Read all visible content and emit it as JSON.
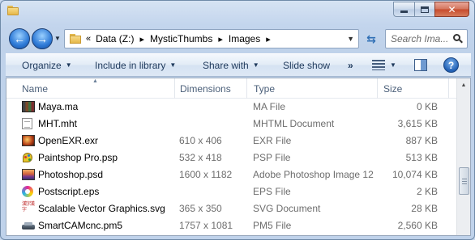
{
  "address": {
    "overflow": "«",
    "crumbs": [
      "Data (Z:)",
      "MysticThumbs",
      "Images"
    ]
  },
  "search": {
    "placeholder": "Search Ima..."
  },
  "toolbar": {
    "organize": "Organize",
    "include_in_library": "Include in library",
    "share_with": "Share with",
    "slide_show": "Slide show",
    "more": "»"
  },
  "columns": {
    "name": "Name",
    "dimensions": "Dimensions",
    "type": "Type",
    "size": "Size"
  },
  "files": [
    {
      "icon": "maya-file-icon",
      "name": "Maya.ma",
      "dimensions": "",
      "type": "MA File",
      "size": "0 KB"
    },
    {
      "icon": "mhtml-file-icon",
      "name": "MHT.mht",
      "dimensions": "",
      "type": "MHTML Document",
      "size": "3,615 KB"
    },
    {
      "icon": "exr-image-icon",
      "name": "OpenEXR.exr",
      "dimensions": "610 x 406",
      "type": "EXR File",
      "size": "887 KB"
    },
    {
      "icon": "paintshop-file-icon",
      "name": "Paintshop Pro.psp",
      "dimensions": "532 x 418",
      "type": "PSP File",
      "size": "513 KB"
    },
    {
      "icon": "psd-image-icon",
      "name": "Photoshop.psd",
      "dimensions": "1600 x 1182",
      "type": "Adobe Photoshop Image 12",
      "size": "10,074 KB"
    },
    {
      "icon": "eps-file-icon",
      "name": "Postscript.eps",
      "dimensions": "",
      "type": "EPS File",
      "size": "2 KB"
    },
    {
      "icon": "svg-image-icon",
      "name": "Scalable Vector Graphics.svg",
      "dimensions": "365 x 350",
      "type": "SVG Document",
      "size": "28 KB"
    },
    {
      "icon": "cnc-machine-icon",
      "name": "SmartCAMcnc.pm5",
      "dimensions": "1757 x 1081",
      "type": "PM5 File",
      "size": "2,560 KB"
    }
  ],
  "svg_icon_glyphs": "漢字漢字",
  "colors": {
    "window_frame": "#c3d5ed",
    "command_bar": "#dde8f5",
    "header_text": "#4c607a",
    "secondary_text": "#6d6d6d"
  }
}
